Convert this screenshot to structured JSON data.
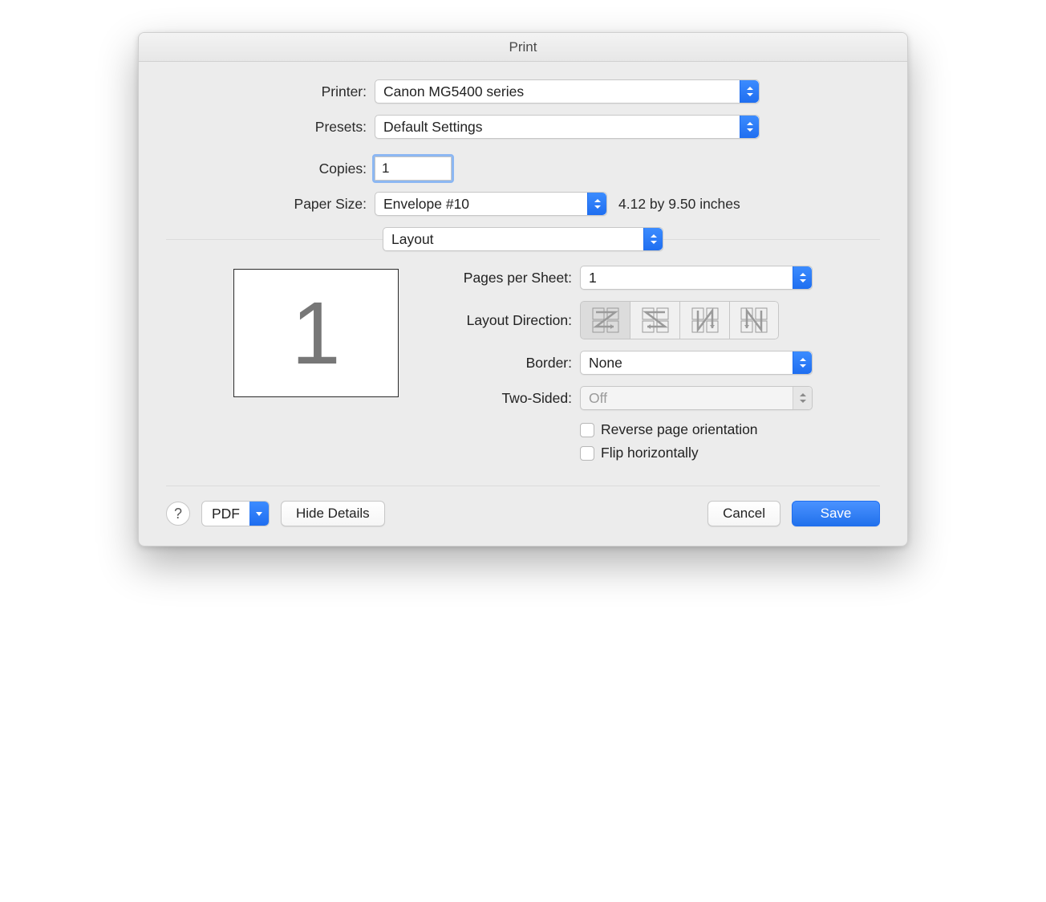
{
  "title": "Print",
  "labels": {
    "printer": "Printer:",
    "presets": "Presets:",
    "copies": "Copies:",
    "papersize": "Paper Size:",
    "section": "Layout",
    "pps": "Pages per Sheet:",
    "layoutdir": "Layout Direction:",
    "border": "Border:",
    "twosided": "Two-Sided:",
    "reverse": "Reverse page orientation",
    "flip": "Flip horizontally"
  },
  "values": {
    "printer": "Canon MG5400 series",
    "presets": "Default Settings",
    "copies": "1",
    "papersize": "Envelope #10",
    "papersize_dim": "4.12 by 9.50 inches",
    "pps": "1",
    "border": "None",
    "twosided": "Off",
    "preview_page": "1"
  },
  "footer": {
    "help": "?",
    "pdf": "PDF",
    "hidedetails": "Hide Details",
    "cancel": "Cancel",
    "save": "Save"
  }
}
